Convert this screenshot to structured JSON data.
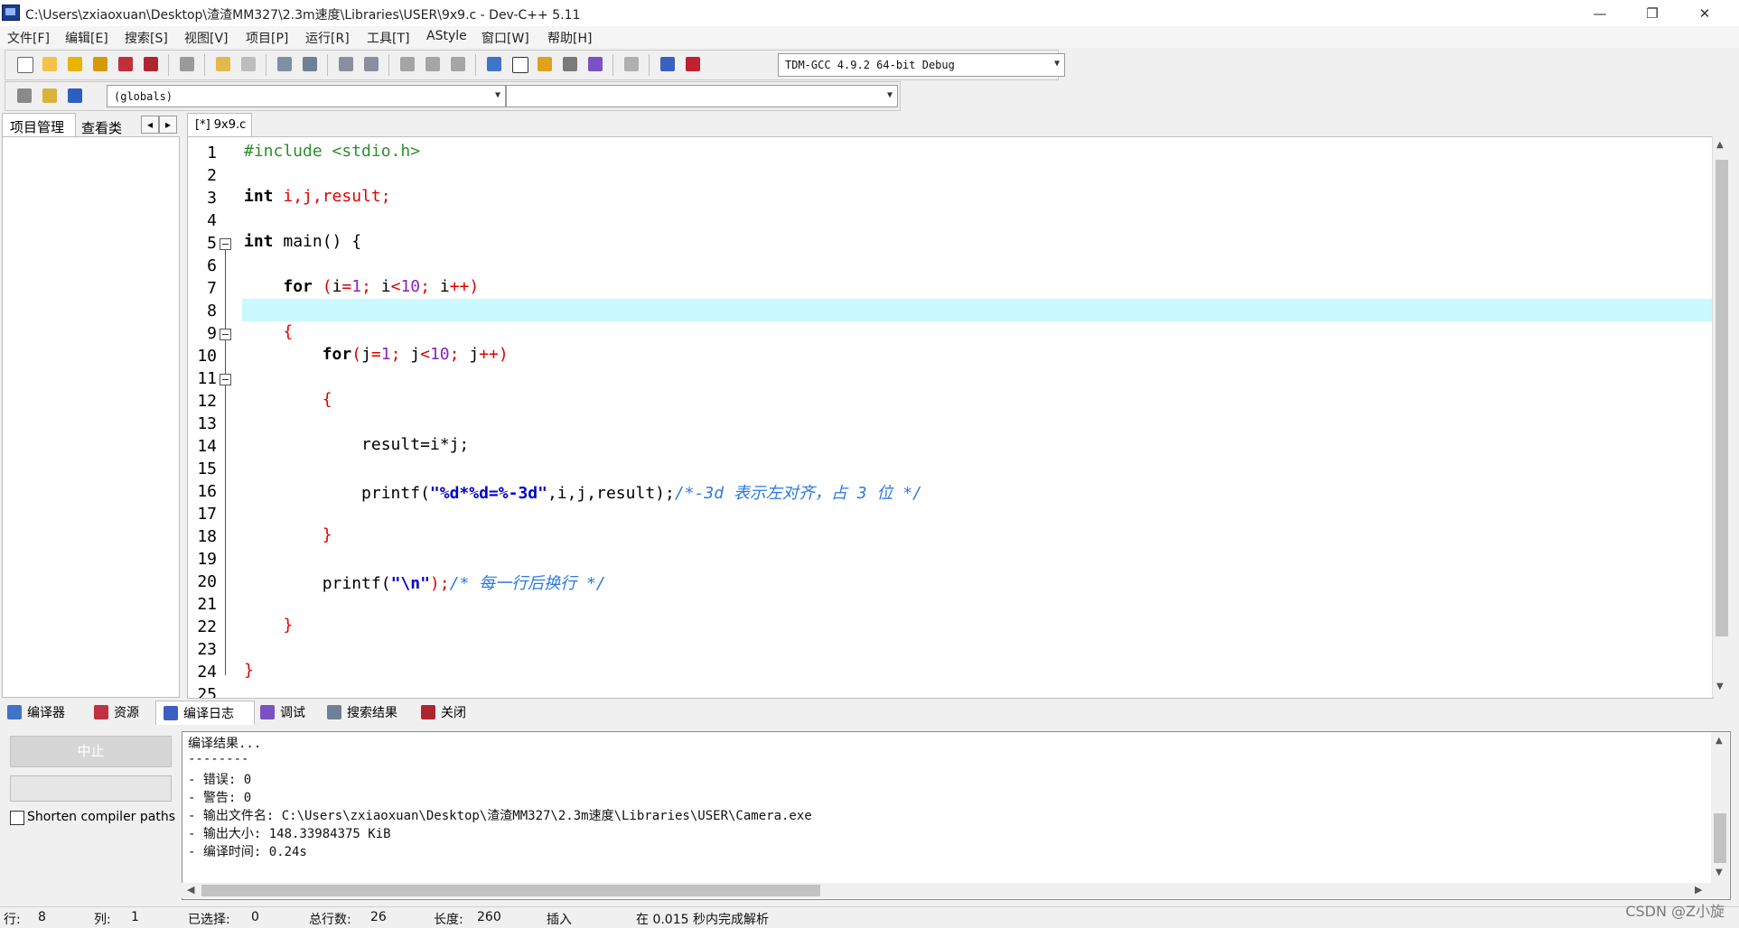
{
  "window": {
    "title": "C:\\Users\\zxiaoxuan\\Desktop\\渣渣MM327\\2.3m速度\\Libraries\\USER\\9x9.c - Dev-C++ 5.11",
    "minimize": "—",
    "maximize": "❐",
    "close": "✕"
  },
  "menu": [
    "文件[F]",
    "编辑[E]",
    "搜索[S]",
    "视图[V]",
    "项目[P]",
    "运行[R]",
    "工具[T]",
    "AStyle",
    "窗口[W]",
    "帮助[H]"
  ],
  "toolbar": {
    "compiler_select": "TDM-GCC 4.9.2 64-bit Debug",
    "scope_select": "(globals)",
    "member_select": ""
  },
  "left_panel": {
    "tabs": [
      "项目管理",
      "查看类"
    ],
    "nav_prev": "◂",
    "nav_next": "▸"
  },
  "editor": {
    "tab_label": "[*] 9x9.c",
    "line_numbers": [
      "1",
      "2",
      "3",
      "4",
      "5",
      "6",
      "7",
      "8",
      "9",
      "10",
      "11",
      "12",
      "13",
      "14",
      "15",
      "16",
      "17",
      "18",
      "19",
      "20",
      "21",
      "22",
      "23",
      "24",
      "25"
    ],
    "current_line": 8,
    "code": {
      "l1": "#include <stdio.h>",
      "l3_kw": "int",
      "l3_rest": " i,j,result;",
      "l5_kw": "int",
      "l5_rest": " main() {",
      "l7_kw": "for",
      "l10_kw": "for",
      "l14": "result=i*j;",
      "l16_fn": "printf(",
      "l16_str": "\"%d*%d=%-3d\"",
      "l16_args": ",i,j,result);",
      "l16_comment": "/*-3d 表示左对齐，占 3 位 */",
      "l20_fn": "printf(",
      "l20_str": "\"\\n\"",
      "l20_end": ");",
      "l20_comment": "/* 每一行后换行 */"
    }
  },
  "bottom_tabs": [
    "编译器",
    "资源",
    "编译日志",
    "调试",
    "搜索结果",
    "关闭"
  ],
  "compile_panel": {
    "stop_button": "中止",
    "shorten_label": "Shorten compiler paths",
    "log_lines": [
      "编译结果...",
      "--------",
      "- 错误: 0",
      "- 警告: 0",
      "- 输出文件名: C:\\Users\\zxiaoxuan\\Desktop\\渣渣MM327\\2.3m速度\\Libraries\\USER\\Camera.exe",
      "- 输出大小: 148.33984375 KiB",
      "- 编译时间: 0.24s"
    ]
  },
  "status": {
    "row_label": "行:",
    "row": "8",
    "col_label": "列:",
    "col": "1",
    "sel_label": "已选择:",
    "sel": "0",
    "lines_label": "总行数:",
    "lines": "26",
    "len_label": "长度:",
    "len": "260",
    "mode": "插入",
    "parse": "在 0.015 秒内完成解析"
  },
  "watermark": "CSDN @Z小旋"
}
